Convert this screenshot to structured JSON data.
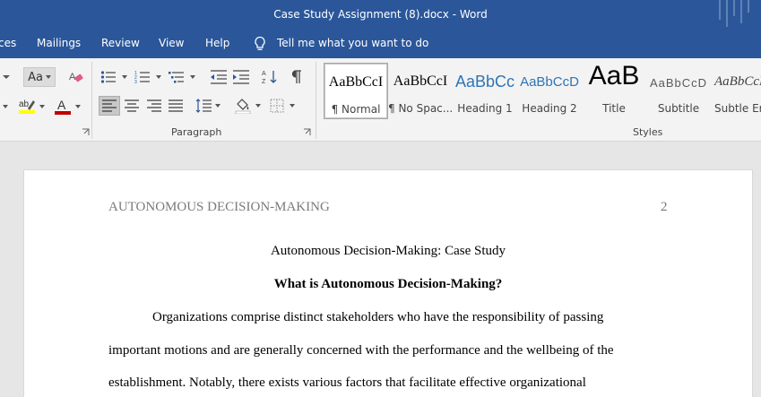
{
  "window": {
    "title": "Case Study Assignment (8).docx  -  Word"
  },
  "ribbon_tabs": [
    {
      "label": "ces"
    },
    {
      "label": "Mailings"
    },
    {
      "label": "Review"
    },
    {
      "label": "View"
    },
    {
      "label": "Help"
    }
  ],
  "tell_me": {
    "label": "Tell me what you want to do"
  },
  "font_group": {
    "change_case_label": "Aa",
    "font_color": "#c00000",
    "highlight_color": "#ffff00"
  },
  "paragraph_group": {
    "label": "Paragraph"
  },
  "styles_group": {
    "label": "Styles",
    "items": [
      {
        "sample": "AaBbCcI",
        "name": "¶ Normal",
        "selected": true
      },
      {
        "sample": "AaBbCcI",
        "name": "¶ No Spac..."
      },
      {
        "sample": "AaBbCc",
        "name": "Heading 1"
      },
      {
        "sample": "AaBbCcD",
        "name": "Heading 2"
      },
      {
        "sample": "AaB",
        "name": "Title"
      },
      {
        "sample": "AaBbCcD",
        "name": "Subtitle"
      },
      {
        "sample": "AaBbCcD",
        "name": "Subtle Em"
      }
    ]
  },
  "document": {
    "running_head": "AUTONOMOUS DECISION-MAKING",
    "page_number": "2",
    "title": "Autonomous Decision-Making: Case Study",
    "heading": "What is Autonomous Decision-Making?",
    "lines": [
      "Organizations comprise distinct stakeholders who have the responsibility of passing",
      "important motions and are generally concerned with the performance and the wellbeing of the",
      "establishment. Notably, there exists various factors that facilitate effective organizational"
    ]
  },
  "colors": {
    "word_blue": "#2b579a",
    "ribbon_bg": "#f3f3f3",
    "canvas_bg": "#e6e6e6"
  }
}
